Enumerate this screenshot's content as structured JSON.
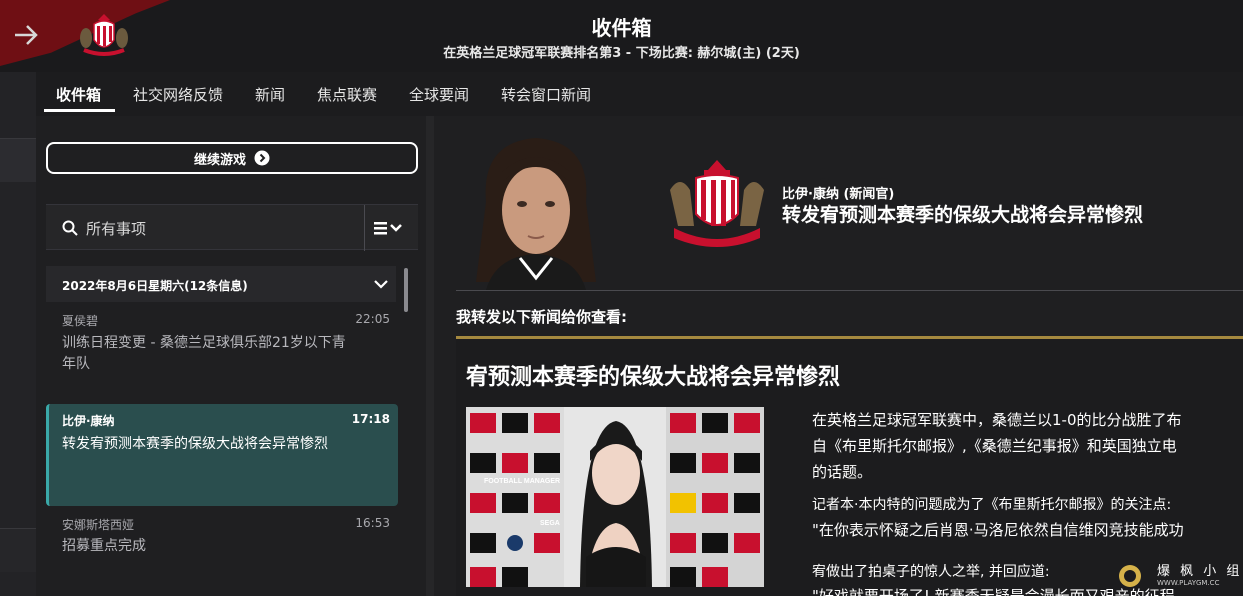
{
  "header": {
    "title": "收件箱",
    "subtitle": "在英格兰足球冠军联赛排名第3 - 下场比赛: 赫尔城(主) (2天)"
  },
  "tabs": [
    {
      "label": "收件箱",
      "active": true
    },
    {
      "label": "社交网络反馈",
      "active": false
    },
    {
      "label": "新闻",
      "active": false
    },
    {
      "label": "焦点联赛",
      "active": false
    },
    {
      "label": "全球要闻",
      "active": false
    },
    {
      "label": "转会窗口新闻",
      "active": false
    }
  ],
  "sidebar": {
    "continue_label": "继续游戏",
    "search_placeholder": "所有事项",
    "date_group": "2022年8月6日星期六(12条信息)",
    "messages": [
      {
        "sender": "夏侯碧",
        "time": "22:05",
        "subject_line1": "训练日程变更 - 桑德兰足球俱乐部21岁以下青",
        "subject_line2": "年队",
        "selected": false
      },
      {
        "sender": "比伊·康纳",
        "time": "17:18",
        "subject_line1": "转发宥预测本赛季的保级大战将会异常惨烈",
        "subject_line2": "",
        "selected": true
      },
      {
        "sender": "安娜斯塔西娅",
        "time": "16:53",
        "subject_line1": "招募重点完成",
        "subject_line2": "",
        "selected": false
      }
    ]
  },
  "news": {
    "sender": "比伊·康纳 (新闻官)",
    "headline": "转发宥预测本赛季的保级大战将会异常惨烈",
    "forward_text": "我转发以下新闻给你查看:",
    "article": {
      "title": "宥预测本赛季的保级大战将会异常惨烈",
      "p1_line1": "在英格兰足球冠军联赛中，桑德兰以1-0的比分战胜了布",
      "p1_line2": "自《布里斯托尔邮报》,《桑德兰纪事报》和英国独立电",
      "p1_line3": "的话题。",
      "p2": "记者本·本内特的问题成为了《布里斯托尔邮报》的关注点:",
      "q1": "\"在你表示怀疑之后肖恩·马洛尼依然自信维冈竞技能成功",
      "p3": "宥做出了拍桌子的惊人之举, 并回应道:",
      "q2": "\"好戏就要开场了! 新赛季无疑是会漫长而又艰辛的征程"
    },
    "image_board_words": [
      "FOOTBALL MANAGER",
      "SEGA"
    ]
  },
  "watermark": {
    "text": "爆 枫 小 组",
    "url": "WWW.PLAYGM.CC"
  },
  "colors": {
    "accent_teal": "#2a4e4e",
    "gold_rule": "#a5893f",
    "brand_red": "#c8102e"
  }
}
